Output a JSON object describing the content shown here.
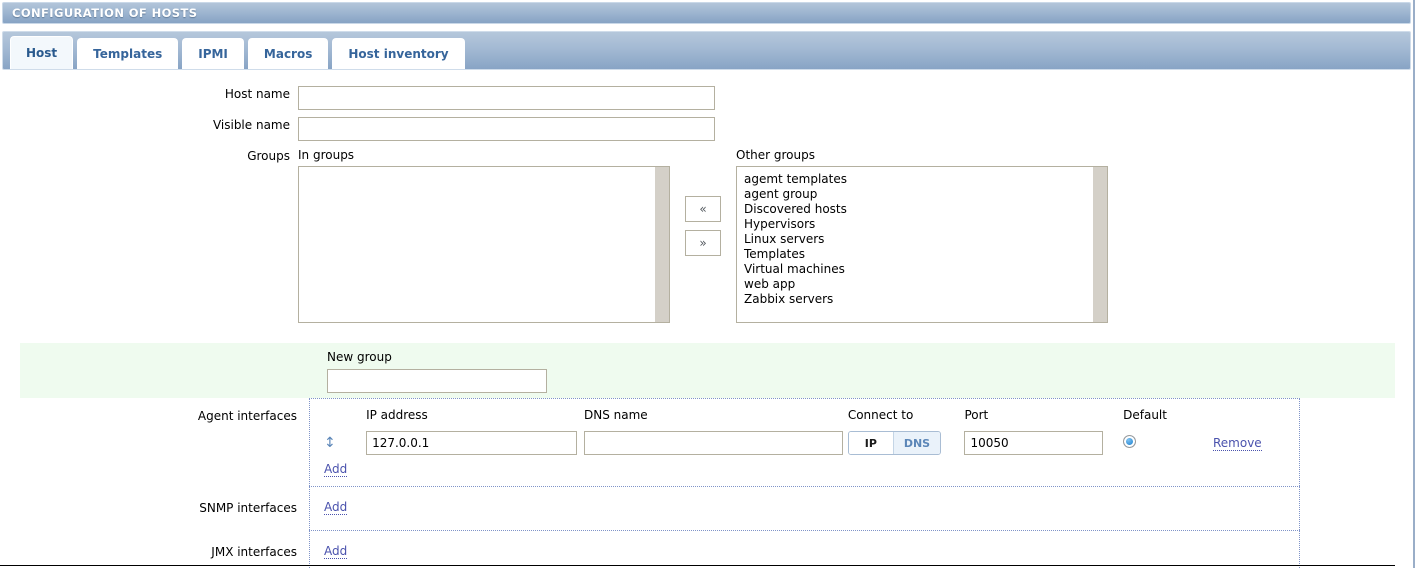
{
  "window": {
    "title": "CONFIGURATION OF HOSTS"
  },
  "tabs": [
    {
      "label": "Host",
      "active": true
    },
    {
      "label": "Templates",
      "active": false
    },
    {
      "label": "IPMI",
      "active": false
    },
    {
      "label": "Macros",
      "active": false
    },
    {
      "label": "Host inventory",
      "active": false
    }
  ],
  "form": {
    "host_name": {
      "label": "Host name",
      "value": "",
      "placeholder": ""
    },
    "visible_name": {
      "label": "Visible name",
      "value": "",
      "placeholder": ""
    },
    "groups": {
      "label": "Groups",
      "in_groups": {
        "caption": "In groups",
        "items": []
      },
      "other_groups": {
        "caption": "Other groups",
        "items": [
          "agemt templates",
          "agent group",
          "Discovered hosts",
          "Hypervisors",
          "Linux servers",
          "Templates",
          "Virtual machines",
          "web app",
          "Zabbix servers"
        ]
      },
      "move_left_label": "«",
      "move_right_label": "»"
    },
    "new_group": {
      "label": "New group",
      "value": "",
      "placeholder": ""
    },
    "agent_interfaces": {
      "label": "Agent interfaces",
      "headers": {
        "ip": "IP address",
        "dns": "DNS name",
        "connect_to": "Connect to",
        "port": "Port",
        "default": "Default"
      },
      "rows": [
        {
          "ip": "127.0.0.1",
          "dns": "",
          "connect_to": "IP",
          "connect_options": [
            "IP",
            "DNS"
          ],
          "port": "10050",
          "is_default": true,
          "remove_label": "Remove"
        }
      ],
      "add_label": "Add"
    },
    "snmp_interfaces": {
      "label": "SNMP interfaces",
      "add_label": "Add"
    },
    "jmx_interfaces": {
      "label": "JMX interfaces",
      "add_label": "Add"
    }
  },
  "colors": {
    "titlebar_blue": "#a1b8d2",
    "tab_text": "#36659b",
    "green_band": "#effbef",
    "link": "#4a52ad",
    "radio_blue": "#2a8ad4"
  }
}
